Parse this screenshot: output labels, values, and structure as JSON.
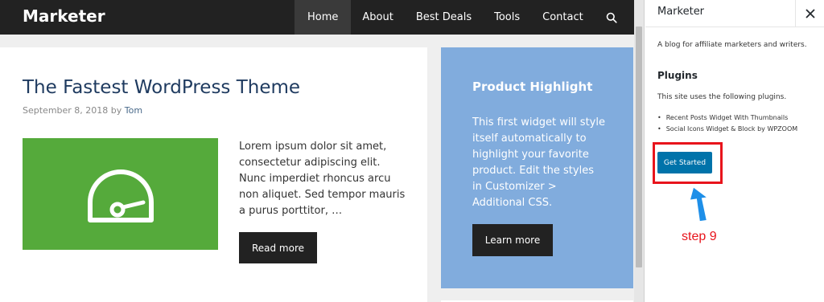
{
  "site": {
    "brand": "Marketer",
    "nav": [
      {
        "label": "Home",
        "active": true
      },
      {
        "label": "About",
        "active": false
      },
      {
        "label": "Best Deals",
        "active": false
      },
      {
        "label": "Tools",
        "active": false
      },
      {
        "label": "Contact",
        "active": false
      }
    ],
    "search_icon": "search-icon"
  },
  "post": {
    "title": "The Fastest WordPress Theme",
    "date": "September 8, 2018",
    "by": "by",
    "author": "Tom",
    "thumbnail_icon": "speedometer-icon",
    "excerpt": "Lorem ipsum dolor sit amet, consectetur adipiscing elit. Nunc imperdiet rhoncus arcu non aliquet. Sed tempor mauris a purus porttitor, …",
    "read_more": "Read more"
  },
  "widget": {
    "title": "Product Highlight",
    "text": "This first widget will style itself automatically to highlight your favorite product. Edit the styles in Customizer > Additional CSS.",
    "button": "Learn more"
  },
  "panel": {
    "title": "Marketer",
    "close_icon": "close-icon",
    "description": "A blog for affiliate marketers and writers.",
    "plugins_heading": "Plugins",
    "plugins_intro": "This site uses the following plugins.",
    "plugins": [
      "Recent Posts Widget With Thumbnails",
      "Social Icons Widget & Block by WPZOOM"
    ],
    "cta_button": "Get Started"
  },
  "annotation": {
    "step_label": "step 9",
    "arrow_icon": "arrow-up-icon"
  },
  "colors": {
    "topbar": "#222222",
    "thumbnail": "#55aa3b",
    "widget": "#81acdd",
    "cta": "#0073aa",
    "annotation": "#e8141c",
    "arrow": "#1e8fe8"
  }
}
